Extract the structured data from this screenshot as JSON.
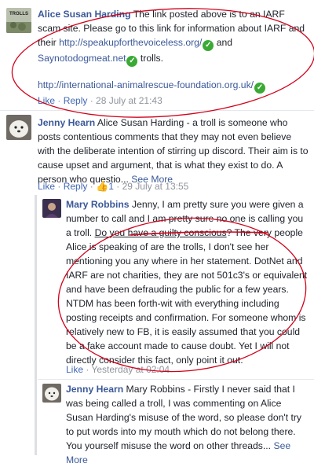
{
  "comments": [
    {
      "author": "Alice Susan Harding",
      "avatar_label": "TROLLS",
      "text_1": "The link posted above is to an IARF scam site. Please go to this link for information about IARF and their",
      "link_1": "http://speakupforthevoiceless.org/",
      "text_2": "and",
      "link_2": "Saynotodogmeat.net",
      "text_3": "trolls.",
      "link_3": "http://international-animalrescue-foundation.org.uk/",
      "like": "Like",
      "reply": "Reply",
      "time": "28 July at 21:43"
    },
    {
      "author": "Jenny Hearn",
      "text": "Alice Susan Harding - a troll is someone who posts contentious comments that they may not even believe with the deliberate intention of stirring up discord. Their aim is to cause upset and argument, that is what they exist to do. A person who questio...",
      "see_more": "See More",
      "like": "Like",
      "reply": "Reply",
      "like_count": "1",
      "time": "29 July at 13:55"
    },
    {
      "author": "Mary Robbins",
      "text_1": "Jenny, I am pretty sure you were given a number to call and I am pretty sure no one is calling you a troll.",
      "underlined": "Do you have a guilty conscious",
      "text_2": "? The very people Alice is speaking of are the trolls, I don't see her mentioning you any where in her statement. DotNet and IARF are not charities, they are not 501c3's or equivalent and have been defrauding the public for a few years. NTDM has been forth-wit with everything including posting receipts and confirmation. For someone whom is relatively new to FB, it is easily assumed that you could be a fake account made to cause doubt. Yet I will not directly consider this fact, only point it out.",
      "like": "Like",
      "time": "Yesterday at 02:04"
    },
    {
      "author": "Jenny Hearn",
      "text": "Mary Robbins - Firstly I never said that I was being called a troll, I was commenting on Alice Susan Harding's misuse of the word, so please don't try to put words into my mouth which do not belong there. You yourself misuse the word on other threads...",
      "see_more": "See More"
    }
  ],
  "colors": {
    "author": "#3b5998",
    "meta": "#90949c",
    "verified": "#3aaa35",
    "annotation": "#d0021b"
  },
  "icons": [
    "verified-check-icon",
    "like-thumb-icon"
  ]
}
